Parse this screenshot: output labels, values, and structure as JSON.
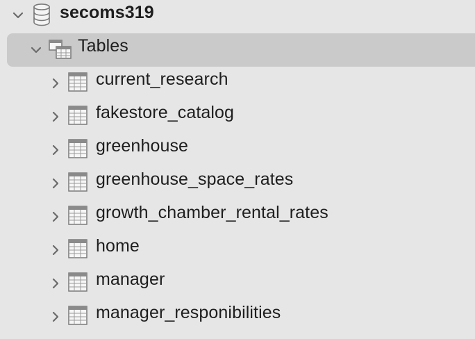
{
  "database": {
    "name": "secoms319",
    "expanded": true
  },
  "tables_folder": {
    "label": "Tables",
    "expanded": true,
    "selected": true
  },
  "tables": [
    {
      "name": "current_research"
    },
    {
      "name": "fakestore_catalog"
    },
    {
      "name": "greenhouse"
    },
    {
      "name": "greenhouse_space_rates"
    },
    {
      "name": "growth_chamber_rental_rates"
    },
    {
      "name": "home"
    },
    {
      "name": "manager"
    },
    {
      "name": "manager_responibilities"
    }
  ],
  "colors": {
    "background": "#e6e6e6",
    "selection": "#cacaca",
    "text": "#1e1e1e",
    "icon": "#6e6e6e"
  }
}
